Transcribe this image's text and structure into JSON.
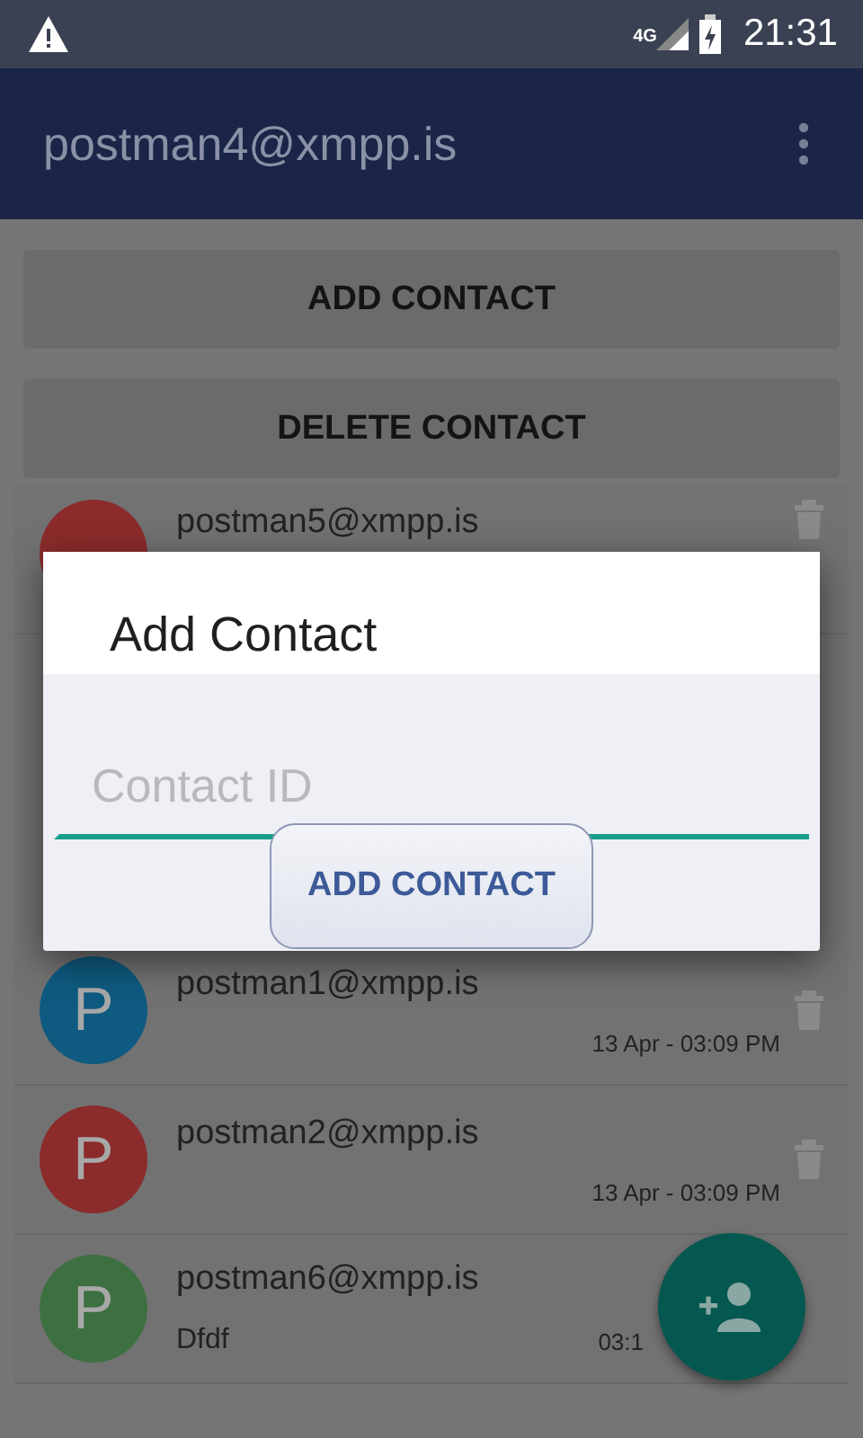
{
  "status_bar": {
    "time": "21:31",
    "network": "4G"
  },
  "app_bar": {
    "title": "postman4@xmpp.is"
  },
  "buttons": [
    "ADD CONTACT",
    "DELETE CONTACT"
  ],
  "contacts": [
    {
      "name": "postman5@xmpp.is",
      "color": "#8b2b2b"
    },
    {
      "initial": "P",
      "name": "postman1@xmpp.is",
      "time": "13 Apr - 03:09 PM",
      "color": "#0f5a80"
    },
    {
      "initial": "P",
      "name": "postman2@xmpp.is",
      "time": "13 Apr - 03:09 PM",
      "color": "#8b2b2b"
    },
    {
      "initial": "P",
      "name": "postman6@xmpp.is",
      "preview": "Dfdf",
      "time": "03:1",
      "color": "#3d7040"
    }
  ],
  "dialog": {
    "title": "Add Contact",
    "placeholder": "Contact ID",
    "button": "ADD CONTACT"
  }
}
